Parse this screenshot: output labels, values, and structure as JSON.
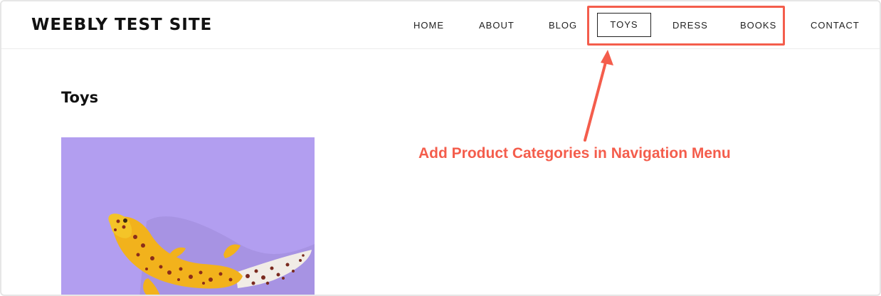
{
  "site": {
    "title": "WEEBLY TEST SITE"
  },
  "nav": {
    "items": [
      {
        "label": "HOME"
      },
      {
        "label": "ABOUT"
      },
      {
        "label": "BLOG"
      },
      {
        "label": "TOYS",
        "active": true
      },
      {
        "label": "DRESS"
      },
      {
        "label": "BOOKS"
      },
      {
        "label": "CONTACT"
      }
    ]
  },
  "page": {
    "heading": "Toys"
  },
  "annotation": {
    "text": "Add Product Categories in Navigation Menu",
    "color": "#f45d4c"
  },
  "colors": {
    "accent": "#f45d4c",
    "image_background": "#b29ef0",
    "text": "#111111"
  }
}
